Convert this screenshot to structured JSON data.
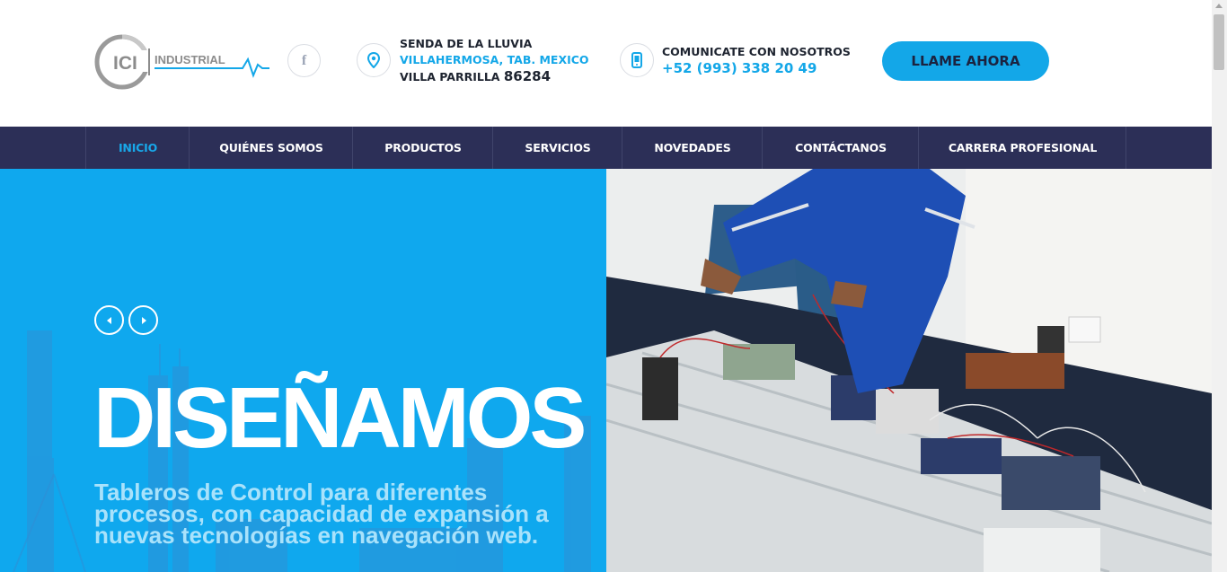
{
  "header": {
    "logo": {
      "mark": "ICI",
      "text": "INDUSTRIAL",
      "icon": "ici-industrial-logo"
    },
    "social": {
      "icon": "facebook-icon",
      "glyph": "f"
    },
    "address": {
      "icon": "location-pin-icon",
      "line1": "SENDA DE LA LLUVIA",
      "line2": "VILLAHERMOSA, TAB. MEXICO",
      "line3": "VILLA PARRILLA",
      "zip": "86284"
    },
    "contact": {
      "icon": "mobile-phone-icon",
      "label": "COMUNICATE CON NOSOTROS",
      "phone": "+52 (993) 338 20 49"
    },
    "cta_label": "LLAME AHORA"
  },
  "nav": {
    "items": [
      {
        "label": "INICIO",
        "active": true
      },
      {
        "label": "QUIÉNES SOMOS"
      },
      {
        "label": "PRODUCTOS"
      },
      {
        "label": "SERVICIOS"
      },
      {
        "label": "NOVEDADES"
      },
      {
        "label": "CONTÁCTANOS"
      },
      {
        "label": "CARRERA PROFESIONAL"
      }
    ]
  },
  "hero": {
    "title": "DISEÑAMOS",
    "description": "Tableros de Control para diferentes procesos, con capacidad de expansión a nuevas tecnologías en navegación web.",
    "prev_icon": "chevron-left-icon",
    "next_icon": "chevron-right-icon",
    "image": "technician-wiring-control-panel-photo"
  },
  "colors": {
    "accent": "#13a7e8",
    "nav_bg": "#2c2f57",
    "hero_bg": "#0fa8ee",
    "text_dark": "#1e2430"
  }
}
